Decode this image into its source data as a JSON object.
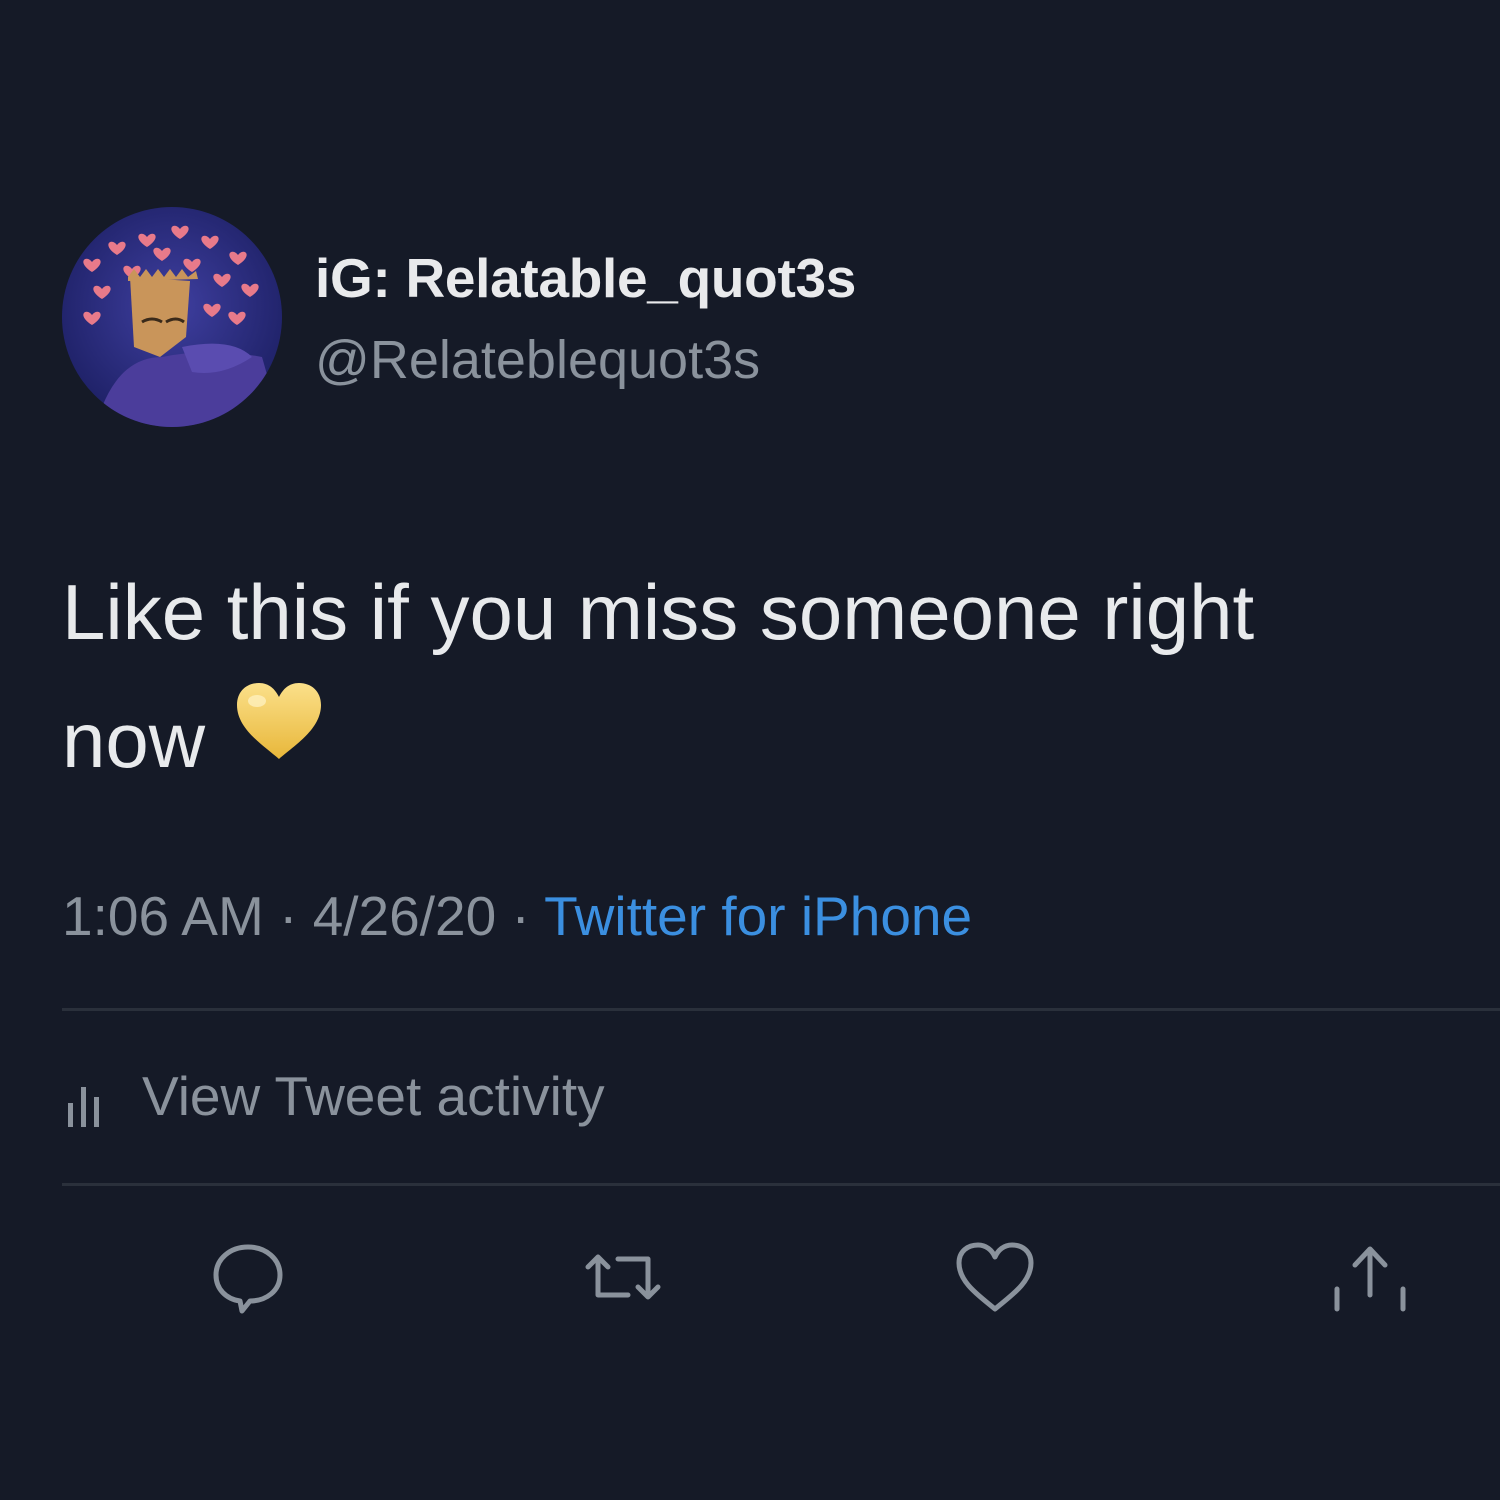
{
  "tweet": {
    "display_name": "iG: Relatable_quot3s",
    "handle": "@Relateblequot3s",
    "text_line1": "Like this if you miss someone right",
    "text_line2": "now",
    "emoji": "yellow-heart",
    "time": "1:06 AM",
    "separator": "·",
    "date": "4/26/20",
    "source": "Twitter for iPhone"
  },
  "activity": {
    "label": "View Tweet activity",
    "icon": "bar-chart-icon"
  },
  "actions": [
    {
      "name": "reply",
      "icon": "speech-bubble-icon"
    },
    {
      "name": "retweet",
      "icon": "retweet-icon"
    },
    {
      "name": "like",
      "icon": "heart-outline-icon"
    },
    {
      "name": "share",
      "icon": "share-arrow-icon"
    }
  ],
  "colors": {
    "background": "#151a27",
    "primary_text": "#e8eaec",
    "secondary_text": "#8a929c",
    "link": "#3b8fe0",
    "emoji_heart": "#f5c842",
    "divider": "#2a303b"
  }
}
